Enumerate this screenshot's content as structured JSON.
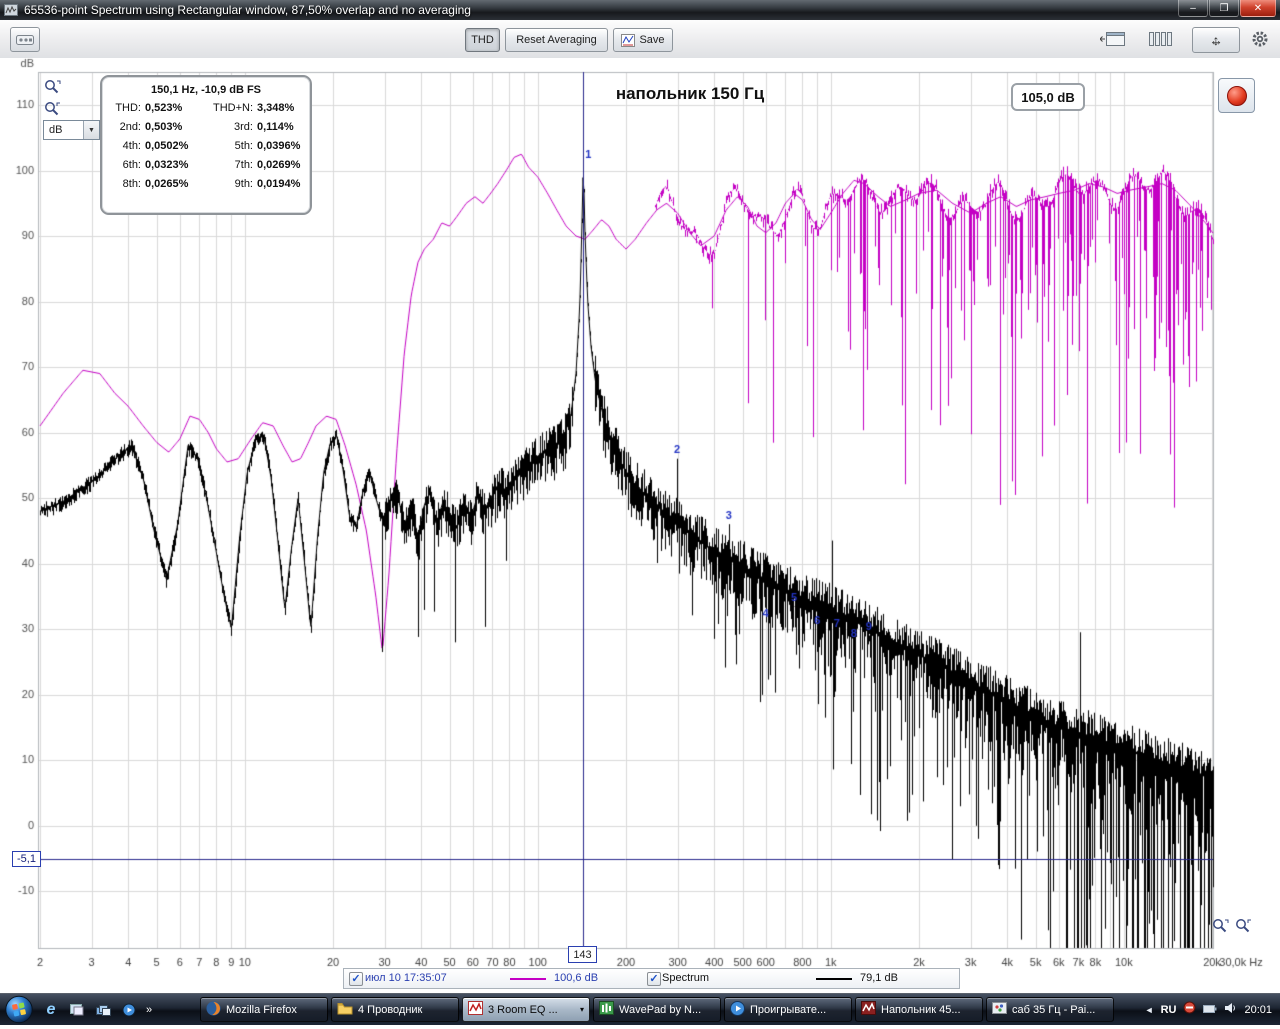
{
  "window": {
    "title": "65536-point Spectrum using Rectangular window, 87,50% overlap and no averaging"
  },
  "icons": {
    "minimize": "–",
    "maximize": "❐",
    "close": "✕",
    "dropdown_arrow": "▼",
    "check": "✓",
    "pan_h": "↔",
    "pan_v": "↕",
    "chevron_right": "»",
    "tray_expand": "◄",
    "task_chevron": "▾"
  },
  "toolbar": {
    "thd_label": "THD",
    "reset_label": "Reset Averaging",
    "save_label": "Save"
  },
  "unit_selector": {
    "value": "dB"
  },
  "chart": {
    "title": "напольник 150 Гц",
    "level_readout": "105,0 dB",
    "cursor_freq_label": "143",
    "cursor_level_label": "-5,1"
  },
  "thd_panel": {
    "header": "150,1 Hz, -10,9 dB FS",
    "rows": [
      [
        "THD:",
        "0,523%",
        "THD+N:",
        "3,348%"
      ],
      [
        "2nd:",
        "0,503%",
        "3rd:",
        "0,114%"
      ],
      [
        "4th:",
        "0,0502%",
        "5th:",
        "0,0396%"
      ],
      [
        "6th:",
        "0,0323%",
        "7th:",
        "0,0269%"
      ],
      [
        "8th:",
        "0,0265%",
        "9th:",
        "0,0194%"
      ]
    ]
  },
  "legend": {
    "entries": [
      {
        "label": "июл 10 17:35:07",
        "value": "100,6 dB",
        "color": "#c400c4",
        "label_color": "#2a3fb0",
        "checked": true
      },
      {
        "label": "Spectrum",
        "value": "79,1 dB",
        "color": "#000000",
        "label_color": "#111111",
        "checked": true
      }
    ]
  },
  "taskbar": {
    "tasks": [
      {
        "label": "Mozilla Firefox",
        "icon": "firefox",
        "active": false
      },
      {
        "label": "4 Проводник",
        "icon": "folder",
        "active": false
      },
      {
        "label": "3 Room EQ ...",
        "icon": "rew",
        "active": true,
        "chevron": true
      },
      {
        "label": "WavePad by N...",
        "icon": "wavepad",
        "active": false
      },
      {
        "label": "Проигрывате...",
        "icon": "wmp",
        "active": false
      },
      {
        "label": "Напольник 45...",
        "icon": "rew2",
        "active": false
      },
      {
        "label": "саб 35 Гц - Pai...",
        "icon": "paint",
        "active": false
      }
    ],
    "tray": {
      "lang": "RU",
      "time": "20:01"
    }
  },
  "chart_data": {
    "type": "line",
    "x_scale": "log",
    "x_unit": "Hz",
    "y_unit": "dB",
    "x_range": [
      2,
      30000
    ],
    "y_range": [
      -10,
      110
    ],
    "grid": true,
    "x_ticks": [
      [
        2,
        "2"
      ],
      [
        3,
        "3"
      ],
      [
        4,
        "4"
      ],
      [
        5,
        "5"
      ],
      [
        6,
        "6"
      ],
      [
        7,
        "7"
      ],
      [
        8,
        "8"
      ],
      [
        9,
        "9"
      ],
      [
        10,
        "10"
      ],
      [
        20,
        "20"
      ],
      [
        30,
        "30"
      ],
      [
        40,
        "40"
      ],
      [
        50,
        "50"
      ],
      [
        60,
        "60"
      ],
      [
        70,
        "70"
      ],
      [
        80,
        "80"
      ],
      [
        100,
        "100"
      ],
      [
        200,
        "200"
      ],
      [
        300,
        "300"
      ],
      [
        400,
        "400"
      ],
      [
        500,
        "500"
      ],
      [
        600,
        "600"
      ],
      [
        800,
        "800"
      ],
      [
        1000,
        "1k"
      ],
      [
        2000,
        "2k"
      ],
      [
        3000,
        "3k"
      ],
      [
        4000,
        "4k"
      ],
      [
        5000,
        "5k"
      ],
      [
        6000,
        "6k"
      ],
      [
        7000,
        "7k"
      ],
      [
        8000,
        "8k"
      ],
      [
        10000,
        "10k"
      ],
      [
        20000,
        "20k"
      ]
    ],
    "x_end_label": "30,0k Hz",
    "y_axis_unit_label": "dB",
    "y_ticks": [
      110,
      100,
      90,
      80,
      70,
      60,
      50,
      40,
      30,
      20,
      10,
      0,
      -10
    ],
    "cursor": {
      "freq": 143,
      "level": -5.1
    },
    "colors": {
      "cursor": "#26268c",
      "grid": "#d9d9d9",
      "harmonic_label": "#2334c4"
    },
    "series": [
      {
        "name": "июл 10 17:35:07",
        "measured_level": "100,6 dB",
        "color": "#c400c4",
        "envelope": [
          2,
          61,
          2.4,
          66,
          2.8,
          69.5,
          3.2,
          69,
          3.6,
          66,
          4,
          64,
          4.5,
          61,
          5,
          58.5,
          5.5,
          57,
          6,
          59,
          6.5,
          62.5,
          7,
          62,
          7.5,
          60,
          8,
          57.5,
          8.7,
          55.5,
          9.5,
          56,
          10.5,
          59,
          11.5,
          61.5,
          12.5,
          61,
          13.5,
          58,
          14.5,
          55.5,
          15.5,
          56,
          16.5,
          58.5,
          17.5,
          61,
          19,
          62.5,
          20.5,
          62,
          22,
          58,
          24,
          52,
          26,
          45,
          28,
          35,
          29.5,
          26.5,
          31,
          38,
          33,
          57,
          35,
          72,
          37,
          81,
          39,
          86,
          41,
          88,
          44,
          89.5,
          47,
          92,
          50,
          91.5,
          53,
          93,
          57,
          95,
          61,
          96,
          65,
          95,
          69,
          96.5,
          73,
          98,
          78,
          100,
          83,
          102,
          88,
          102.5,
          93,
          100.5,
          100,
          99,
          108,
          96.5,
          116,
          94,
          125,
          91.5,
          135,
          90,
          145,
          89.5,
          155,
          91,
          165,
          92.5,
          175,
          91.5,
          185,
          89.5,
          200,
          88,
          215,
          89.5,
          235,
          92,
          255,
          94,
          275,
          95,
          300,
          93.5,
          330,
          90.5,
          360,
          88.5,
          400,
          90,
          440,
          94,
          480,
          96,
          520,
          94.5,
          560,
          91.5,
          600,
          90.5,
          650,
          92,
          700,
          95,
          750,
          96.5,
          800,
          95.5,
          860,
          92.5,
          920,
          91,
          1000,
          93.5,
          1100,
          96.5,
          1200,
          98.5,
          1300,
          98,
          1450,
          96,
          1600,
          94.5,
          1800,
          95.5,
          2000,
          96.5,
          2300,
          97,
          2600,
          95,
          3000,
          93.5,
          3400,
          95,
          3800,
          96,
          4300,
          94.5,
          4800,
          95.5,
          5400,
          96,
          6000,
          96.5,
          6800,
          97,
          7600,
          98,
          8500,
          97.5,
          9500,
          96.5,
          10500,
          97,
          12000,
          97.5,
          13500,
          98,
          15000,
          97,
          17000,
          94.5,
          19000,
          92,
          20500,
          90
        ]
      },
      {
        "name": "Spectrum",
        "measured_level": "79,1 dB",
        "color": "#000000",
        "envelope": [
          2,
          48,
          2.4,
          49.5,
          2.8,
          51.5,
          3.2,
          53.5,
          3.7,
          56.5,
          4.1,
          58,
          4.5,
          53,
          4.9,
          45,
          5.4,
          37.5,
          5.9,
          46,
          6.4,
          58,
          6.9,
          56,
          7.4,
          50,
          7.9,
          43,
          8.5,
          35,
          9,
          30,
          9.6,
          44,
          10.2,
          54,
          10.9,
          59,
          11.6,
          59.5,
          12.3,
          53,
          13,
          43,
          13.7,
          33,
          14.4,
          42,
          15.2,
          50,
          16,
          40,
          16.8,
          30,
          17.7,
          44,
          18.6,
          54,
          19.6,
          58.5,
          20.6,
          59.5,
          21.7,
          54,
          22.8,
          47,
          24,
          45.5,
          25.3,
          51,
          26.6,
          54,
          28,
          50,
          29.5,
          46.5,
          31,
          49,
          33,
          51,
          35,
          46,
          37,
          48.5,
          39,
          44,
          41,
          49,
          43,
          51,
          45,
          46,
          47.5,
          49.5,
          50,
          47.5,
          53,
          45.5,
          56,
          49,
          59,
          47,
          62,
          50,
          66,
          48,
          70,
          50.5,
          74,
          52,
          78,
          51,
          82,
          53,
          87,
          54,
          92,
          55,
          98,
          56,
          104,
          57,
          110,
          57.5,
          117,
          58.5,
          124,
          60,
          130,
          63,
          135,
          69,
          139,
          79,
          141,
          89,
          143,
          101,
          145,
          90,
          148,
          80,
          152,
          73,
          157,
          68,
          163,
          64.5,
          170,
          61.5,
          178,
          59,
          187,
          56.5,
          197,
          54.5,
          210,
          52.5,
          225,
          51,
          245,
          49.5,
          265,
          48,
          290,
          46.5,
          320,
          45,
          355,
          43.5,
          395,
          42,
          440,
          41,
          490,
          40,
          545,
          38.5,
          605,
          37.5,
          670,
          36.5,
          745,
          35.5,
          825,
          34.5,
          915,
          33.5,
          1000,
          33,
          1150,
          31.5,
          1300,
          30.5,
          1500,
          29,
          1750,
          27.5,
          2000,
          26,
          2350,
          24.5,
          2700,
          23,
          3100,
          21.5,
          3600,
          20,
          4200,
          18.5,
          4900,
          17,
          5700,
          15.5,
          6600,
          14.5,
          7700,
          13.5,
          9000,
          12.5,
          10500,
          11.5,
          12000,
          10.5,
          14000,
          9.5,
          16500,
          8.5,
          19000,
          7.5,
          21000,
          7
        ]
      }
    ],
    "harmonics": [
      {
        "n": 1,
        "freq": 143,
        "db": 101
      },
      {
        "n": 2,
        "freq": 299,
        "db": 56
      },
      {
        "n": 3,
        "freq": 449,
        "db": 46
      },
      {
        "n": 4,
        "freq": 599,
        "db": 31
      },
      {
        "n": 5,
        "freq": 749,
        "db": 33.5
      },
      {
        "n": 6,
        "freq": 899,
        "db": 30
      },
      {
        "n": 7,
        "freq": 1049,
        "db": 29.5
      },
      {
        "n": 8,
        "freq": 1199,
        "db": 28
      },
      {
        "n": 9,
        "freq": 1349,
        "db": 29
      }
    ],
    "extra_spikes": [
      [
        1010,
        43.5
      ],
      [
        7100,
        29.5
      ]
    ]
  }
}
